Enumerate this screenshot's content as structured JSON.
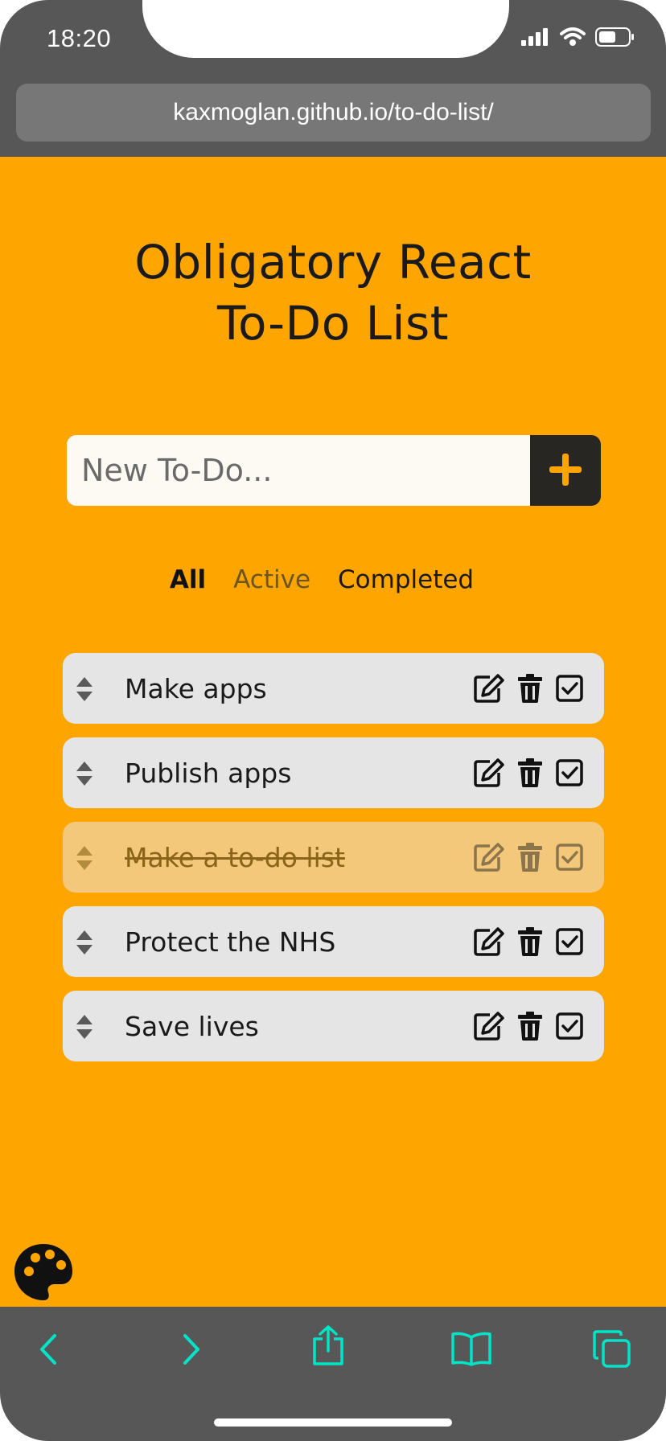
{
  "status_bar": {
    "time": "18:20"
  },
  "browser": {
    "url": "kaxmoglan.github.io/to-do-list/"
  },
  "app": {
    "title_line1": "Obligatory React",
    "title_line2": "To-Do List",
    "new_todo_placeholder": "New To-Do...",
    "filters": {
      "all": "All",
      "active": "Active",
      "completed": "Completed"
    },
    "todos": [
      {
        "text": "Make apps",
        "completed": false
      },
      {
        "text": "Publish apps",
        "completed": false
      },
      {
        "text": "Make a to-do list",
        "completed": true
      },
      {
        "text": "Protect the NHS",
        "completed": false
      },
      {
        "text": "Save lives",
        "completed": false
      }
    ]
  },
  "colors": {
    "background": "#ffa500",
    "todo_item": "#e5e5e5",
    "todo_item_completed": "#f3c87a",
    "add_button": "#272622",
    "add_icon": "#ffa500",
    "toolbar_icons": "#00e5c8"
  },
  "icons": [
    "signal-icon",
    "wifi-icon",
    "battery-icon",
    "plus-icon",
    "drag-handle-icon",
    "edit-icon",
    "trash-icon",
    "checkbox-icon",
    "palette-icon",
    "back-icon",
    "forward-icon",
    "share-icon",
    "bookmarks-icon",
    "tabs-icon"
  ]
}
